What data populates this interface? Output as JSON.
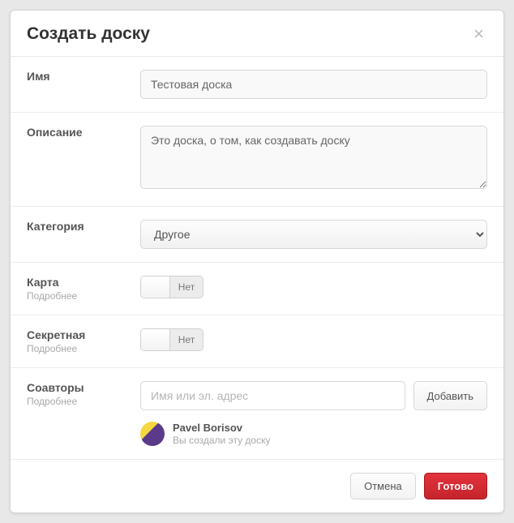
{
  "modal": {
    "title": "Создать доску"
  },
  "fields": {
    "name": {
      "label": "Имя",
      "value": "Тестовая доска"
    },
    "description": {
      "label": "Описание",
      "value": "Это доска, о том, как создавать доску"
    },
    "category": {
      "label": "Категория",
      "selected": "Другое"
    },
    "map": {
      "label": "Карта",
      "sub": "Подробнее",
      "toggle_text": "Нет"
    },
    "secret": {
      "label": "Секретная",
      "sub": "Подробнее",
      "toggle_text": "Нет"
    },
    "collaborators": {
      "label": "Соавторы",
      "sub": "Подробнее",
      "placeholder": "Имя или эл. адрес",
      "add_button": "Добавить",
      "user": {
        "name": "Pavel Borisov",
        "note": "Вы создали эту доску"
      }
    }
  },
  "footer": {
    "cancel": "Отмена",
    "submit": "Готово"
  }
}
